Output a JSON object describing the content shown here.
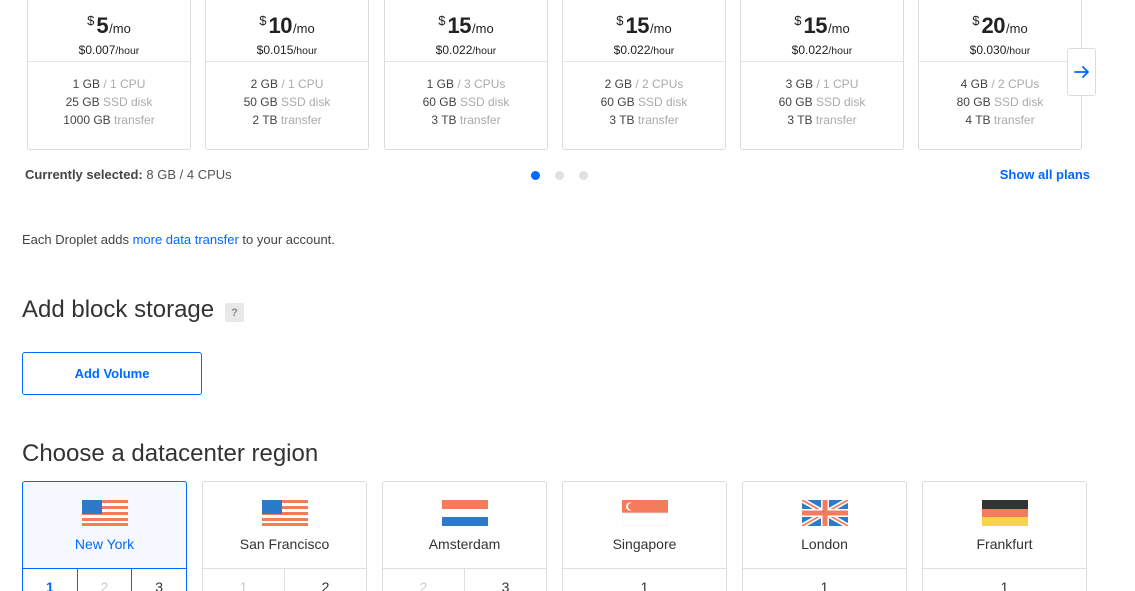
{
  "plans": [
    {
      "currency": "$",
      "amount": "5",
      "period": "/mo",
      "hourly": "$0.007",
      "hourly_unit": "/hour",
      "memory": "1 GB",
      "cpu": "/ 1 CPU",
      "disk": "25 GB",
      "disk_label": "SSD disk",
      "transfer": "1000 GB",
      "transfer_label": "transfer"
    },
    {
      "currency": "$",
      "amount": "10",
      "period": "/mo",
      "hourly": "$0.015",
      "hourly_unit": "/hour",
      "memory": "2 GB",
      "cpu": "/ 1 CPU",
      "disk": "50 GB",
      "disk_label": "SSD disk",
      "transfer": "2 TB",
      "transfer_label": "transfer"
    },
    {
      "currency": "$",
      "amount": "15",
      "period": "/mo",
      "hourly": "$0.022",
      "hourly_unit": "/hour",
      "memory": "1 GB",
      "cpu": "/ 3 CPUs",
      "disk": "60 GB",
      "disk_label": "SSD disk",
      "transfer": "3 TB",
      "transfer_label": "transfer"
    },
    {
      "currency": "$",
      "amount": "15",
      "period": "/mo",
      "hourly": "$0.022",
      "hourly_unit": "/hour",
      "memory": "2 GB",
      "cpu": "/ 2 CPUs",
      "disk": "60 GB",
      "disk_label": "SSD disk",
      "transfer": "3 TB",
      "transfer_label": "transfer"
    },
    {
      "currency": "$",
      "amount": "15",
      "period": "/mo",
      "hourly": "$0.022",
      "hourly_unit": "/hour",
      "memory": "3 GB",
      "cpu": "/ 1 CPU",
      "disk": "60 GB",
      "disk_label": "SSD disk",
      "transfer": "3 TB",
      "transfer_label": "transfer"
    },
    {
      "currency": "$",
      "amount": "20",
      "period": "/mo",
      "hourly": "$0.030",
      "hourly_unit": "/hour",
      "memory": "4 GB",
      "cpu": "/ 2 CPUs",
      "disk": "80 GB",
      "disk_label": "SSD disk",
      "transfer": "4 TB",
      "transfer_label": "transfer"
    }
  ],
  "next_icon": "arrow-right-icon",
  "selection": {
    "label": "Currently selected:",
    "value": "8 GB / 4 CPUs"
  },
  "pagination": {
    "pages": 3,
    "active": 1
  },
  "show_all_label": "Show all plans",
  "droplet_note": {
    "prefix": "Each Droplet adds ",
    "link": "more data transfer",
    "suffix": " to your account."
  },
  "block_storage": {
    "title": "Add block storage",
    "help": "?",
    "button": "Add Volume"
  },
  "datacenter": {
    "title": "Choose a datacenter region"
  },
  "regions": [
    {
      "name": "New York",
      "flag": "us-flag",
      "selected": true,
      "numbers": [
        {
          "n": "1",
          "state": "sel"
        },
        {
          "n": "2",
          "state": "dim"
        },
        {
          "n": "3",
          "state": "normal"
        }
      ]
    },
    {
      "name": "San Francisco",
      "flag": "us-flag",
      "selected": false,
      "numbers": [
        {
          "n": "1",
          "state": "dim"
        },
        {
          "n": "2",
          "state": "normal"
        }
      ]
    },
    {
      "name": "Amsterdam",
      "flag": "nl-flag",
      "selected": false,
      "numbers": [
        {
          "n": "2",
          "state": "dim"
        },
        {
          "n": "3",
          "state": "normal"
        }
      ]
    },
    {
      "name": "Singapore",
      "flag": "sg-flag",
      "selected": false,
      "numbers": [
        {
          "n": "1",
          "state": "normal"
        }
      ]
    },
    {
      "name": "London",
      "flag": "uk-flag",
      "selected": false,
      "numbers": [
        {
          "n": "1",
          "state": "normal"
        }
      ]
    },
    {
      "name": "Frankfurt",
      "flag": "de-flag",
      "selected": false,
      "numbers": [
        {
          "n": "1",
          "state": "normal"
        }
      ]
    }
  ],
  "colors": {
    "accent": "#0069ff",
    "border": "#dcdcdc",
    "muted": "#aaaaaa"
  }
}
